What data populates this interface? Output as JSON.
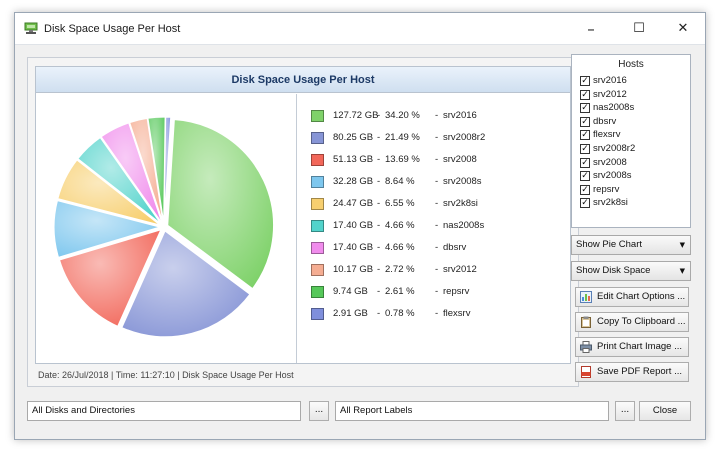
{
  "window": {
    "title": "Disk Space Usage Per Host",
    "minimize_glyph": "–",
    "maximize_glyph": "☐",
    "close_glyph": "✕"
  },
  "chart_data": {
    "type": "pie",
    "title": "Disk Space Usage Per Host",
    "legend_position": "right",
    "slices": [
      {
        "label": "srv2016",
        "size": "127.72 GB",
        "percent_text": "34.20 %",
        "value": 34.2,
        "color": "#7fd26a"
      },
      {
        "label": "srv2008r2",
        "size": "80.25 GB",
        "percent_text": "21.49 %",
        "value": 21.49,
        "color": "#8795d6"
      },
      {
        "label": "srv2008",
        "size": "51.13 GB",
        "percent_text": "13.69 %",
        "value": 13.69,
        "color": "#f2675a"
      },
      {
        "label": "srv2008s",
        "size": "32.28 GB",
        "percent_text": "8.64 %",
        "value": 8.64,
        "color": "#7ec7ee"
      },
      {
        "label": "srv2k8si",
        "size": "24.47 GB",
        "percent_text": "6.55 %",
        "value": 6.55,
        "color": "#f7cf6f"
      },
      {
        "label": "nas2008s",
        "size": "17.40 GB",
        "percent_text": "4.66 %",
        "value": 4.66,
        "color": "#52d3cb"
      },
      {
        "label": "dbsrv",
        "size": "17.40 GB",
        "percent_text": "4.66 %",
        "value": 4.66,
        "color": "#f08cec"
      },
      {
        "label": "srv2012",
        "size": "10.17 GB",
        "percent_text": "2.72 %",
        "value": 2.72,
        "color": "#f5ad92"
      },
      {
        "label": "repsrv",
        "size": "9.74 GB",
        "percent_text": "2.61 %",
        "value": 2.61,
        "color": "#56c85a"
      },
      {
        "label": "flexsrv",
        "size": "2.91 GB",
        "percent_text": "0.78 %",
        "value": 0.78,
        "color": "#7f8fdc"
      }
    ],
    "dash": "-"
  },
  "chart_status": "Date: 26/Jul/2018 | Time: 11:27:10 | Disk Space Usage Per Host",
  "hosts": {
    "title": "Hosts",
    "check_glyph": "✓",
    "items": [
      {
        "label": "srv2016",
        "checked": true
      },
      {
        "label": "srv2012",
        "checked": true
      },
      {
        "label": "nas2008s",
        "checked": true
      },
      {
        "label": "dbsrv",
        "checked": true
      },
      {
        "label": "flexsrv",
        "checked": true
      },
      {
        "label": "srv2008r2",
        "checked": true
      },
      {
        "label": "srv2008",
        "checked": true
      },
      {
        "label": "srv2008s",
        "checked": true
      },
      {
        "label": "repsrv",
        "checked": true
      },
      {
        "label": "srv2k8si",
        "checked": true
      }
    ]
  },
  "combos": {
    "chart_type": "Show Pie Chart",
    "metric": "Show Disk Space",
    "arrow_glyph": "▼"
  },
  "actions": {
    "edit_chart_options": "Edit Chart Options ...",
    "copy_to_clipboard": "Copy To Clipboard ...",
    "print_chart_image": "Print Chart Image ...",
    "save_pdf_report": "Save PDF Report ..."
  },
  "bottom": {
    "scope_value": "All Disks and Directories",
    "labels_value": "All Report Labels",
    "dots_label": "...",
    "close_label": "Close"
  }
}
